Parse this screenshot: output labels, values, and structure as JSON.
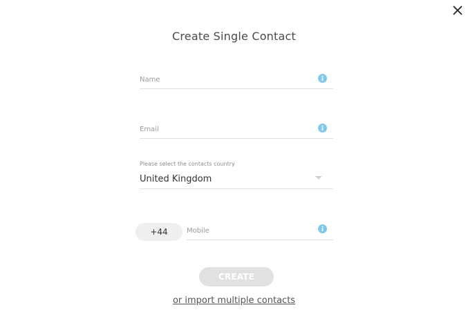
{
  "dialog": {
    "title": "Create Single Contact",
    "close_icon": "close-icon"
  },
  "fields": {
    "name": {
      "value": "",
      "placeholder": "Name",
      "icon": "info-icon"
    },
    "email": {
      "value": "",
      "placeholder": "Email",
      "icon": "info-icon"
    },
    "country": {
      "label": "Please select the contacts country",
      "selected": "United Kingdom",
      "icon": "chevron-down-icon"
    },
    "mobile": {
      "prefix": "+44",
      "value": "",
      "placeholder": "Mobile",
      "icon": "info-icon"
    }
  },
  "actions": {
    "create_label": "CREATE",
    "import_link": "or import multiple contacts"
  },
  "colors": {
    "info_icon": "#7fc8e8",
    "button_disabled": "#e1e1e1",
    "text": "#4a4a4a"
  }
}
